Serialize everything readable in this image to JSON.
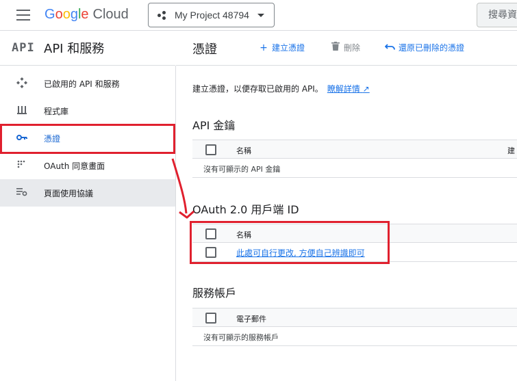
{
  "header": {
    "logo_google": "Google",
    "logo_cloud": "Cloud",
    "project_name": "My Project 48794",
    "search_placeholder": "搜尋資"
  },
  "section": {
    "badge": "API",
    "title": "API 和服務"
  },
  "sidebar": {
    "items": [
      {
        "label": "已啟用的 API 和服務",
        "icon": "api-diamond-icon"
      },
      {
        "label": "程式庫",
        "icon": "library-icon"
      },
      {
        "label": "憑證",
        "icon": "key-icon",
        "active": true
      },
      {
        "label": "OAuth 同意畫面",
        "icon": "oauth-dots-icon"
      },
      {
        "label": "頁面使用協議",
        "icon": "settings-list-icon"
      }
    ]
  },
  "main": {
    "title": "憑證",
    "actions": {
      "create": "建立憑證",
      "delete": "刪除",
      "restore": "還原已刪除的憑證"
    },
    "description": "建立憑證，以便存取已啟用的 API。",
    "learn_more": "瞭解詳情",
    "api_keys": {
      "title": "API 金鑰",
      "col_name": "名稱",
      "col_right": "建",
      "empty": "沒有可顯示的 API 金鑰"
    },
    "oauth": {
      "title": "OAuth 2.0 用戶端 ID",
      "col_name": "名稱",
      "row_link": "此處可自行更改, 方便自己辨識即可"
    },
    "service_accounts": {
      "title": "服務帳戶",
      "col_email": "電子郵件",
      "empty": "沒有可顯示的服務帳戶"
    }
  },
  "colors": {
    "accent": "#1a73e8",
    "annotation_red": "#e0202e"
  }
}
